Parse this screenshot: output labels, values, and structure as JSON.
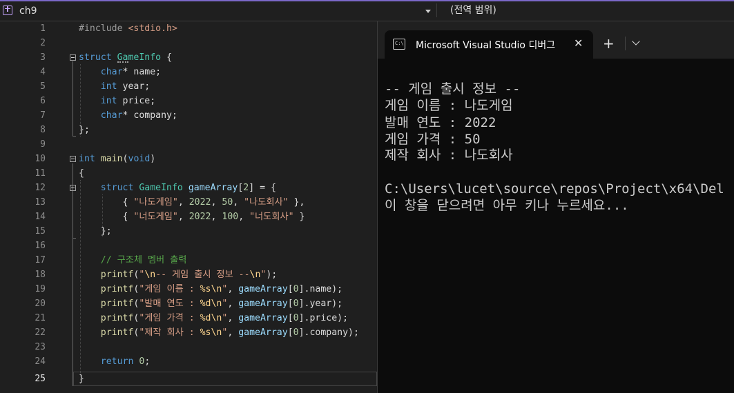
{
  "toolbar": {
    "project_scope": "ch9",
    "member_scope": "(전역 범위)"
  },
  "editor": {
    "line_numbers": [
      "1",
      "2",
      "3",
      "4",
      "5",
      "6",
      "7",
      "8",
      "9",
      "10",
      "11",
      "12",
      "13",
      "14",
      "15",
      "16",
      "17",
      "18",
      "19",
      "20",
      "21",
      "22",
      "23",
      "24",
      "25"
    ],
    "current_line": "25",
    "lines": {
      "l1_directive": "#include",
      "l1_header": "<stdio.h>",
      "l3_kw": "struct",
      "l3_name": "GameInfo",
      "l3_rest": " {",
      "l4_type": "char",
      "l4_rest": "* name;",
      "l5_type": "int",
      "l5_rest": " year;",
      "l6_type": "int",
      "l6_rest": " price;",
      "l7_type": "char",
      "l7_rest": "* company;",
      "l8": "};",
      "l10_kw": "int",
      "l10_fn": "main",
      "l10_open": "(",
      "l10_param": "void",
      "l10_close": ")",
      "l11": "{",
      "l12_kw": "struct",
      "l12_type": "GameInfo",
      "l12_var": "gameArray",
      "l12_open": "[",
      "l12_num": "2",
      "l12_rest": "] = {",
      "l13_open": "{ ",
      "l13_str1": "\"나도게임\"",
      "l13_sep1": ", ",
      "l13_num1": "2022",
      "l13_sep2": ", ",
      "l13_num2": "50",
      "l13_sep3": ", ",
      "l13_str2": "\"나도회사\"",
      "l13_close": " },",
      "l14_open": "{ ",
      "l14_str1": "\"너도게임\"",
      "l14_sep1": ", ",
      "l14_num1": "2022",
      "l14_sep2": ", ",
      "l14_num2": "100",
      "l14_sep3": ", ",
      "l14_str2": "\"너도회사\"",
      "l14_close": " }",
      "l15": "};",
      "l17_comment": "// 구조체 멤버 출력",
      "l18_fn": "printf",
      "l18_open": "(",
      "l18_q1": "\"",
      "l18_esc1": "\\n",
      "l18_str": "-- 게임 출시 정보 --",
      "l18_esc2": "\\n",
      "l18_q2": "\"",
      "l18_close": ");",
      "l19_fn": "printf",
      "l19_open": "(",
      "l19_str": "\"게임 이름 : ",
      "l19_fmt": "%s",
      "l19_esc": "\\n",
      "l19_q": "\"",
      "l19_comma": ", ",
      "l19_var": "gameArray",
      "l19_idx_open": "[",
      "l19_idx": "0",
      "l19_rest": "].name);",
      "l20_fn": "printf",
      "l20_open": "(",
      "l20_str": "\"발매 연도 : ",
      "l20_fmt": "%d",
      "l20_esc": "\\n",
      "l20_q": "\"",
      "l20_comma": ", ",
      "l20_var": "gameArray",
      "l20_idx_open": "[",
      "l20_idx": "0",
      "l20_rest": "].year);",
      "l21_fn": "printf",
      "l21_open": "(",
      "l21_str": "\"게임 가격 : ",
      "l21_fmt": "%d",
      "l21_esc": "\\n",
      "l21_q": "\"",
      "l21_comma": ", ",
      "l21_var": "gameArray",
      "l21_idx_open": "[",
      "l21_idx": "0",
      "l21_rest": "].price);",
      "l22_fn": "printf",
      "l22_open": "(",
      "l22_str": "\"제작 회사 : ",
      "l22_fmt": "%s",
      "l22_esc": "\\n",
      "l22_q": "\"",
      "l22_comma": ", ",
      "l22_var": "gameArray",
      "l22_idx_open": "[",
      "l22_idx": "0",
      "l22_rest": "].company);",
      "l24_kw": "return",
      "l24_sp": " ",
      "l24_num": "0",
      "l24_semi": ";",
      "l25": "}"
    }
  },
  "console": {
    "tab_title": "Microsoft Visual Studio 디버그",
    "icon_text": "C:\\",
    "close_glyph": "✕",
    "new_tab_glyph": "+",
    "output_lines": [
      "-- 게임 출시 정보 --",
      "게임 이름 : 나도게임",
      "발매 연도 : 2022",
      "게임 가격 : 50",
      "제작 회사 : 나도회사",
      "",
      "C:\\Users\\lucet\\source\\repos\\Project\\x64\\Del",
      "이 창을 닫으려면 아무 키나 누르세요..."
    ]
  }
}
